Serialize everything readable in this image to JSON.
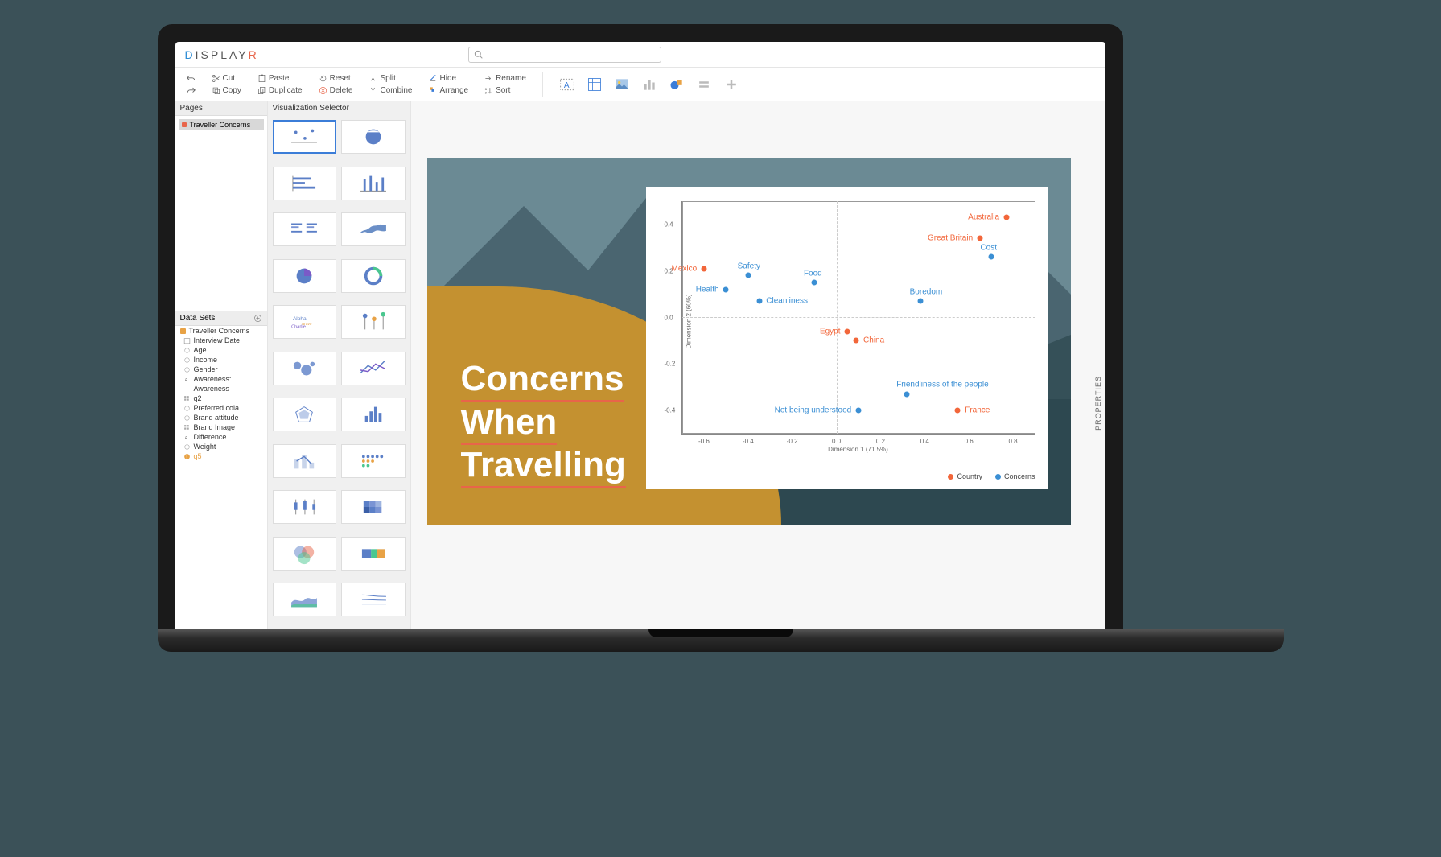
{
  "app": {
    "logo": "DISPLAYR"
  },
  "search": {
    "placeholder": ""
  },
  "toolbar": {
    "undo": "",
    "redo": "",
    "cut": "Cut",
    "copy": "Copy",
    "paste": "Paste",
    "duplicate": "Duplicate",
    "reset": "Reset",
    "delete": "Delete",
    "split": "Split",
    "combine": "Combine",
    "hide": "Hide",
    "arrange": "Arrange",
    "rename": "Rename",
    "sort": "Sort"
  },
  "panels": {
    "pages_title": "Pages",
    "page_item": "Traveller Concerns",
    "viz_title": "Visualization Selector",
    "datasets_title": "Data Sets",
    "properties_tab": "PROPERTIES"
  },
  "datasets": {
    "name": "Traveller Concerns",
    "items": [
      {
        "icon": "cal",
        "label": "Interview Date"
      },
      {
        "icon": "num",
        "label": "Age"
      },
      {
        "icon": "num",
        "label": "Income"
      },
      {
        "icon": "num",
        "label": "Gender"
      },
      {
        "icon": "a",
        "label": "Awareness:"
      },
      {
        "icon": "blank",
        "label": "Awareness"
      },
      {
        "icon": "grid",
        "label": "q2"
      },
      {
        "icon": "num",
        "label": "Preferred cola"
      },
      {
        "icon": "num",
        "label": "Brand attitude"
      },
      {
        "icon": "grid",
        "label": "Brand Image"
      },
      {
        "icon": "a",
        "label": "Difference"
      },
      {
        "icon": "num",
        "label": "Weight"
      },
      {
        "icon": "warn",
        "label": "q5"
      }
    ]
  },
  "slide": {
    "title_line1": "Concerns",
    "title_line2": "When",
    "title_line3": "Travelling"
  },
  "chart_data": {
    "type": "scatter",
    "xlabel": "Dimension 1 (71.5%)",
    "ylabel": "Dimension 2 (60%)",
    "xlim": [
      -0.7,
      0.9
    ],
    "ylim": [
      -0.5,
      0.5
    ],
    "xticks": [
      -0.6,
      -0.4,
      -0.2,
      0.0,
      0.2,
      0.4,
      0.6,
      0.8
    ],
    "yticks": [
      -0.4,
      -0.2,
      0.0,
      0.2,
      0.4
    ],
    "legend": [
      {
        "name": "Country",
        "color": "#f2663a"
      },
      {
        "name": "Concerns",
        "color": "#3b8fd4"
      }
    ],
    "series": [
      {
        "name": "Country",
        "color": "#f2663a",
        "points": [
          {
            "label": "Mexico",
            "x": -0.6,
            "y": 0.21,
            "la": "left"
          },
          {
            "label": "Egypt",
            "x": 0.05,
            "y": -0.06,
            "la": "left"
          },
          {
            "label": "China",
            "x": 0.09,
            "y": -0.1,
            "la": "right"
          },
          {
            "label": "Australia",
            "x": 0.77,
            "y": 0.43,
            "la": "left"
          },
          {
            "label": "Great Britain",
            "x": 0.65,
            "y": 0.34,
            "la": "left"
          },
          {
            "label": "France",
            "x": 0.55,
            "y": -0.4,
            "la": "right"
          }
        ]
      },
      {
        "name": "Concerns",
        "color": "#3b8fd4",
        "points": [
          {
            "label": "Health",
            "x": -0.5,
            "y": 0.12,
            "la": "left"
          },
          {
            "label": "Safety",
            "x": -0.4,
            "y": 0.18,
            "la": "top"
          },
          {
            "label": "Cleanliness",
            "x": -0.35,
            "y": 0.07,
            "la": "right"
          },
          {
            "label": "Food",
            "x": -0.1,
            "y": 0.15,
            "la": "top"
          },
          {
            "label": "Boredom",
            "x": 0.38,
            "y": 0.07,
            "la": "top"
          },
          {
            "label": "Cost",
            "x": 0.7,
            "y": 0.26,
            "la": "top"
          },
          {
            "label": "Friendliness of the people",
            "x": 0.32,
            "y": -0.33,
            "la": "top"
          },
          {
            "label": "Not being understood",
            "x": 0.1,
            "y": -0.4,
            "la": "left"
          }
        ]
      }
    ]
  }
}
